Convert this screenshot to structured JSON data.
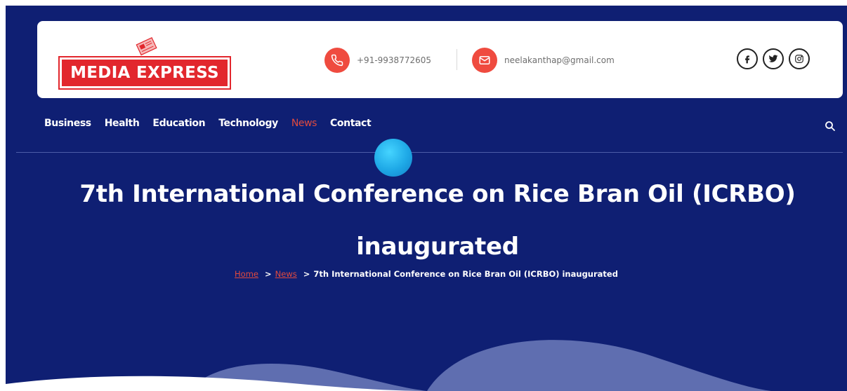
{
  "brand": {
    "logo_text": "MEDIA EXPRESS",
    "accent": "#e2272d"
  },
  "contact": {
    "phone": "+91-9938772605",
    "email": "neelakanthap@gmail.com",
    "phone_icon": "phone-icon",
    "email_icon": "mail-icon"
  },
  "social": [
    "facebook-icon",
    "twitter-icon",
    "instagram-icon"
  ],
  "nav": {
    "items": [
      {
        "label": "Business",
        "active": false
      },
      {
        "label": "Health",
        "active": false
      },
      {
        "label": "Education",
        "active": false
      },
      {
        "label": "Technology",
        "active": false
      },
      {
        "label": "News",
        "active": true
      },
      {
        "label": "Contact",
        "active": false
      }
    ],
    "search_icon": "search-icon"
  },
  "page": {
    "title_line1": "7th International Conference on Rice Bran Oil (ICRBO)",
    "title_line2": "inaugurated"
  },
  "breadcrumb": {
    "home": "Home",
    "section": "News",
    "separator": ">",
    "current": "7th International Conference on Rice Bran Oil (ICRBO) inaugurated"
  },
  "colors": {
    "hero_bg": "#0f1f73",
    "active_link": "#e04a3f",
    "orb": "#1ea8e6"
  }
}
